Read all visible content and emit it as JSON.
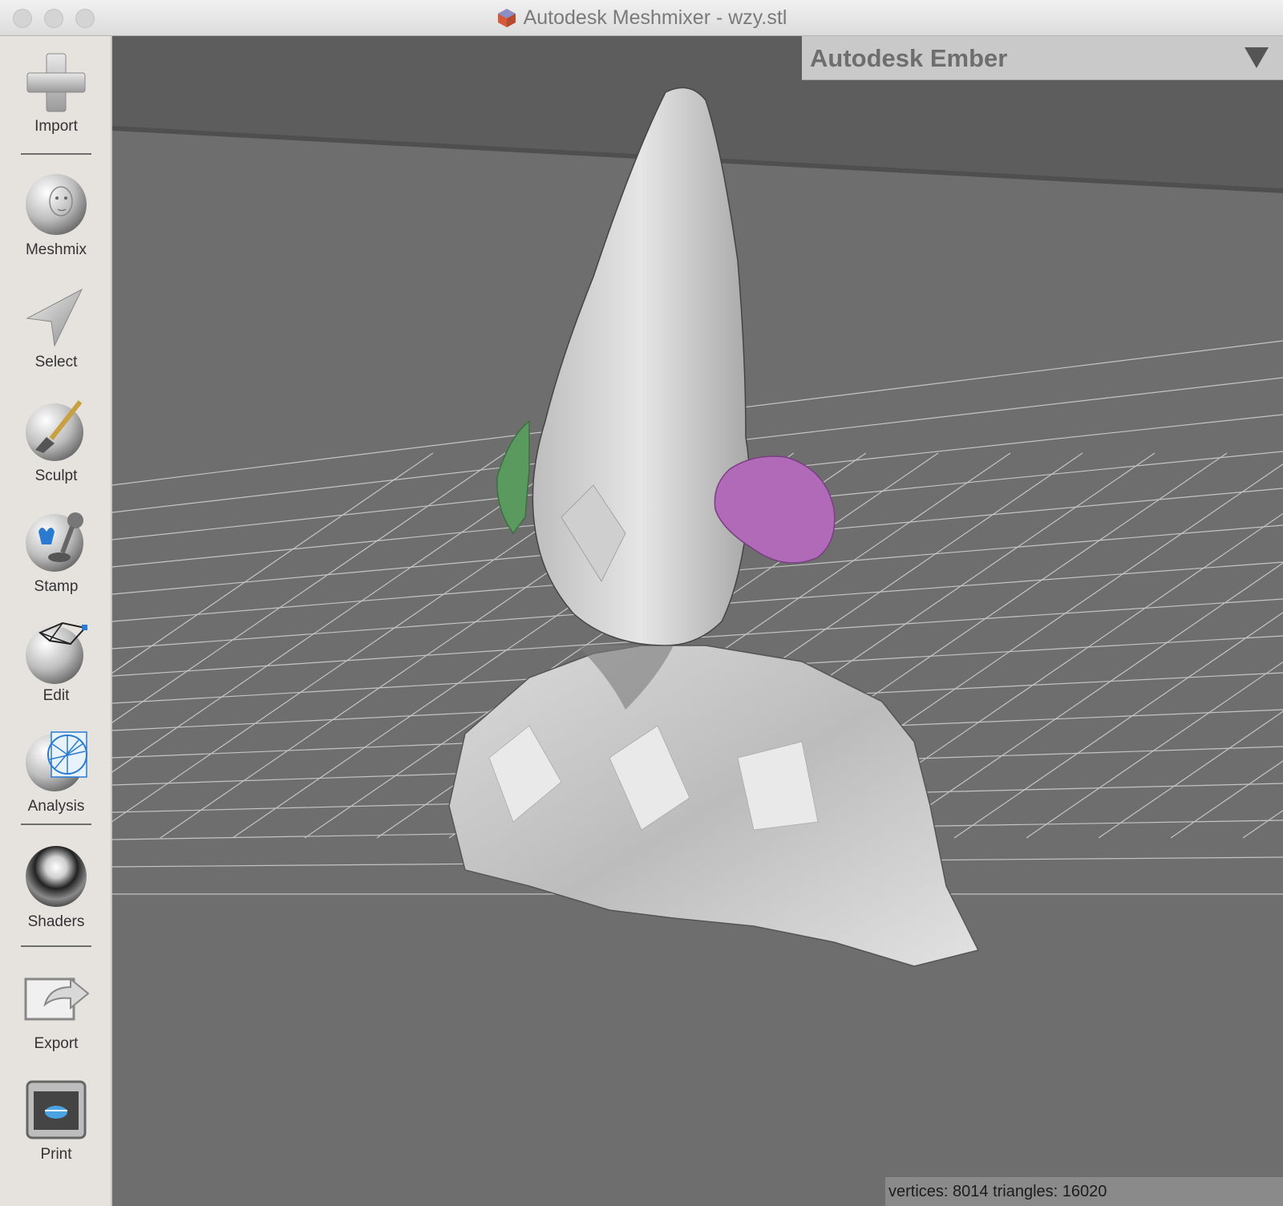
{
  "window": {
    "title": "Autodesk Meshmixer - wzy.stl",
    "app_icon": "meshmixer-cube-icon"
  },
  "sidebar": {
    "tools": [
      {
        "label": "Import",
        "icon": "plus-icon"
      },
      {
        "label": "Meshmix",
        "icon": "face-sphere-icon"
      },
      {
        "label": "Select",
        "icon": "arrow-cursor-icon"
      },
      {
        "label": "Sculpt",
        "icon": "brush-sphere-icon"
      },
      {
        "label": "Stamp",
        "icon": "stamp-icon"
      },
      {
        "label": "Edit",
        "icon": "wireframe-sphere-icon"
      },
      {
        "label": "Analysis",
        "icon": "mesh-analysis-icon"
      },
      {
        "label": "Shaders",
        "icon": "chrome-sphere-icon"
      },
      {
        "label": "Export",
        "icon": "export-arrow-icon"
      },
      {
        "label": "Print",
        "icon": "printer-icon"
      }
    ]
  },
  "printer_panel": {
    "title": "Autodesk Ember",
    "dropdown_icon": "triangle-down-icon"
  },
  "status": {
    "text": "vertices: 8014 triangles: 16020"
  },
  "colors": {
    "viewport_bg": "#6e6e6e",
    "mesh": "#cfcfcf",
    "ear_left": "#5a9a5e",
    "ear_right": "#b06ab8"
  }
}
